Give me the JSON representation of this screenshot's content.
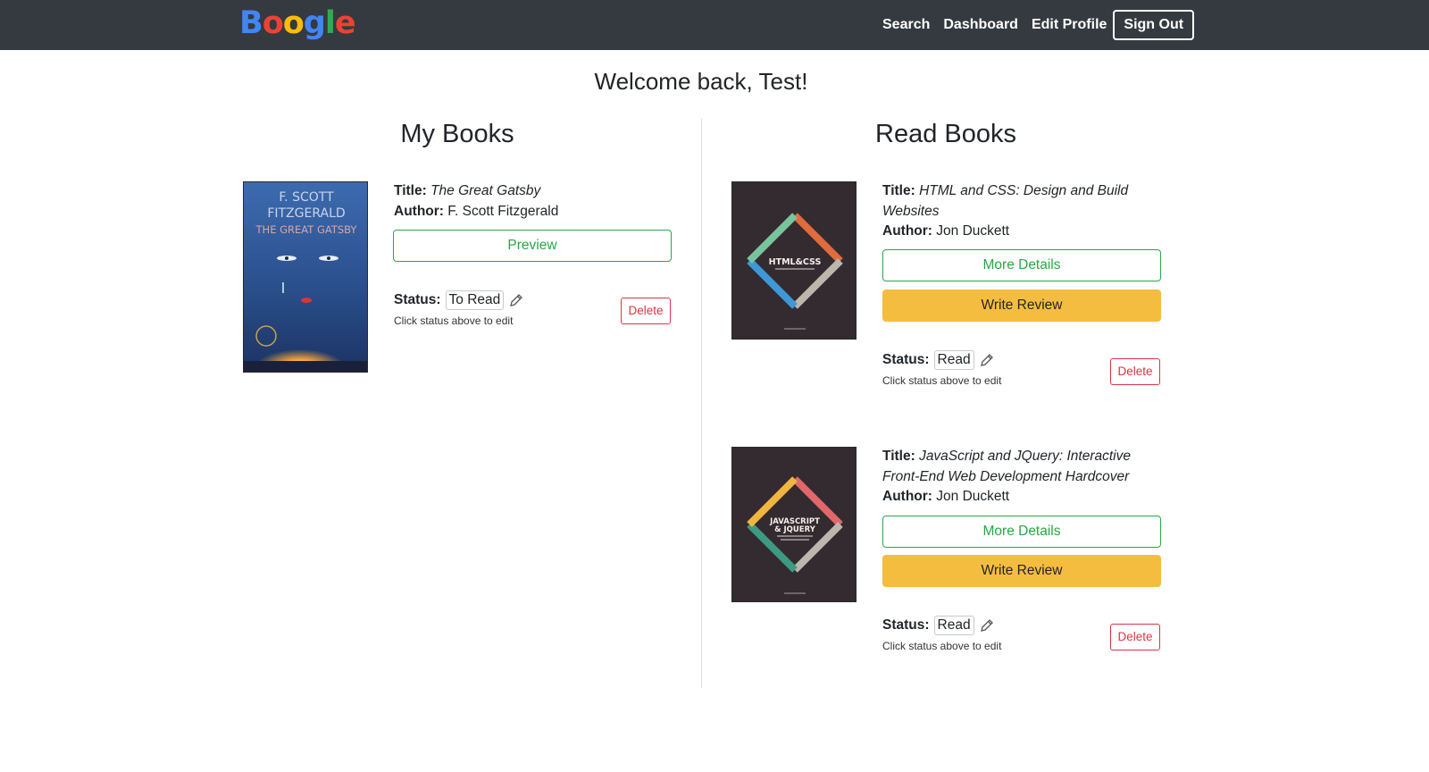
{
  "nav": {
    "brand": [
      "B",
      "o",
      "o",
      "g",
      "l",
      "e"
    ],
    "brand_colors": [
      "#4285F4",
      "#EA4335",
      "#FBBC05",
      "#4285F4",
      "#34A853",
      "#EA4335"
    ],
    "links": [
      "Search",
      "Dashboard",
      "Edit Profile"
    ],
    "signout": "Sign Out"
  },
  "welcome": "Welcome back, Test!",
  "my_books": {
    "heading": "My Books",
    "books": [
      {
        "title_label": "Title:",
        "title": "The Great Gatsby",
        "author_label": "Author:",
        "author": "F. Scott Fitzgerald",
        "preview_label": "Preview",
        "status_label": "Status:",
        "status": "To Read",
        "hint": "Click status above to edit",
        "delete_label": "Delete",
        "cover": {
          "line1": "F. SCOTT",
          "line2": "FITZGERALD",
          "line3": "THE GREAT GATSBY"
        }
      }
    ]
  },
  "read_books": {
    "heading": "Read Books",
    "books": [
      {
        "title_label": "Title:",
        "title": "HTML and CSS: Design and Build Websites",
        "author_label": "Author:",
        "author": "Jon Duckett",
        "details_label": "More Details",
        "review_label": "Write Review",
        "status_label": "Status:",
        "status": "Read",
        "hint": "Click status above to edit",
        "delete_label": "Delete",
        "cover": {
          "text": "HTML&CSS"
        }
      },
      {
        "title_label": "Title:",
        "title": "JavaScript and JQuery: Interactive Front-End Web Development Hardcover",
        "author_label": "Author:",
        "author": "Jon Duckett",
        "details_label": "More Details",
        "review_label": "Write Review",
        "status_label": "Status:",
        "status": "Read",
        "hint": "Click status above to edit",
        "delete_label": "Delete",
        "cover": {
          "line1": "JAVASCRIPT",
          "line2": "& JQUERY"
        }
      }
    ]
  },
  "colors": {
    "navbar": "#343a40",
    "success": "#28a745",
    "warning": "#f5bd3f",
    "danger": "#dc3545"
  }
}
